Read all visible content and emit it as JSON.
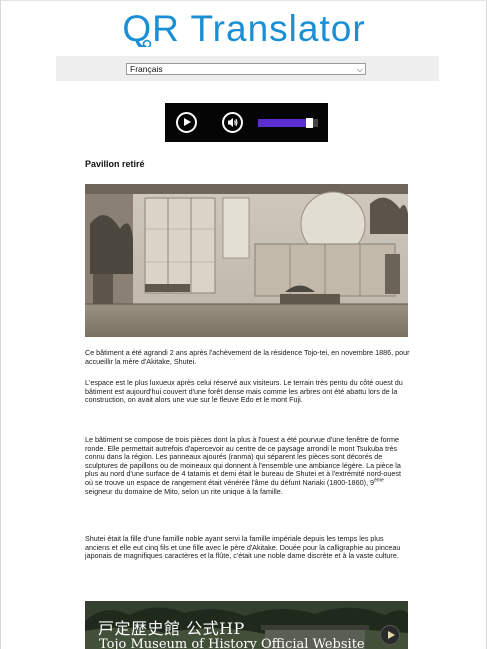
{
  "header": {
    "logo_text": "QR Translator",
    "logo_color": "#1a8fd6"
  },
  "language": {
    "selected": "Français",
    "chevron_icon": "chevron-down-icon"
  },
  "audio_player": {
    "play_icon": "play-icon",
    "volume_icon": "volume-icon",
    "volume_level": 0.92,
    "accent_color": "#5a2fd0"
  },
  "article": {
    "title": "Pavillon retiré",
    "paragraphs": [
      "Ce bâtiment a été agrandi 2 ans après l'achèvement de la résidence Tojo-tei, en novembre 1886, pour accueillir la mère d'Akitake, Shutei.",
      "L'espace est le plus luxueux après celui réservé aux visiteurs. Le terrain très pentu du côté ouest du bâtiment est aujourd'hui couvert d'une forêt dense mais comme les arbres ont été abattu lors de la construction, on avait alors une vue sur le fleuve Edo et le mont Fuji.",
      "Shutei était la fille d'une famille noble ayant servi la famille impériale depuis les temps les plus anciens et elle eut cinq fils et une fille avec le père d'Akitake. Douée pour la calligraphie au pinceau japonais de magnifiques caractères et la flûte, c'était une noble dame discrète et à la vaste culture."
    ],
    "paragraph3_main": "Le bâtiment se compose de trois pièces dont la plus à l'ouest a été pourvue d'une fenêtre de forme ronde. Elle permettait autrefois d'apercevoir au centre de ce paysage arrondi le mont Tsukuba très connu dans la région. Les panneaux ajourés (ranma) qui séparent les pièces sont décorés de sculptures de papillons ou de moineaux qui donnent à l'ensemble une ambiance légère. La pièce la plus au nord d'une surface de 4 tatamis et demi était le bureau de Shutei et à l'extrémité nord-ouest où se trouve un espace de rangement était vénérée l'âme du défunt Nariaki (1800-1860), 9",
    "paragraph3_sup": "ème",
    "paragraph3_tail": " seigneur du domaine de Mito, selon un rite unique à la famille."
  },
  "banner": {
    "title_jp": "戸定歴史館 公式HP",
    "title_en": "Tojo Museum of History Official Website",
    "play_icon": "play-circle-icon"
  }
}
